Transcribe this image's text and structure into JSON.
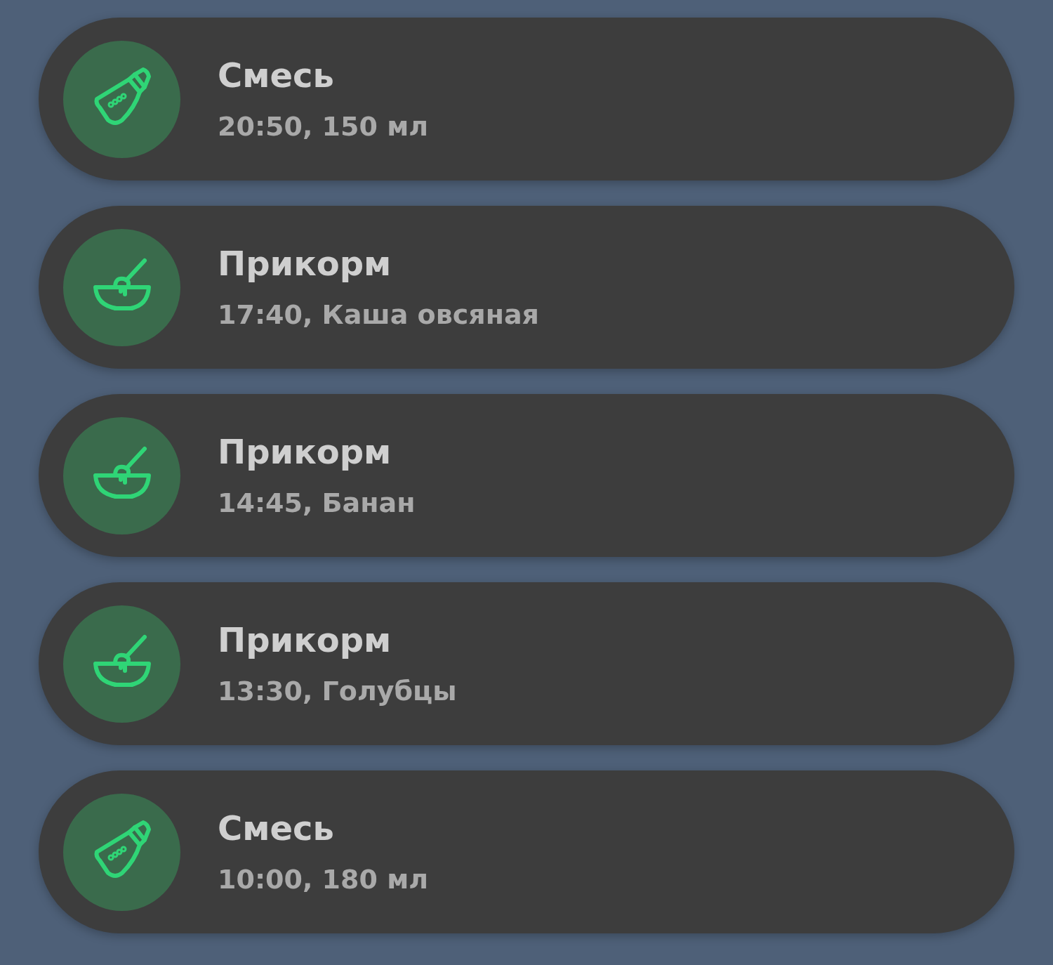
{
  "entries": [
    {
      "kind": "bottle",
      "title": "Смесь",
      "details": "20:50, 150 мл"
    },
    {
      "kind": "bowl",
      "title": "Прикорм",
      "details": "17:40, Каша овсяная"
    },
    {
      "kind": "bowl",
      "title": "Прикорм",
      "details": "14:45, Банан"
    },
    {
      "kind": "bowl",
      "title": "Прикорм",
      "details": "13:30, Голубцы"
    },
    {
      "kind": "bottle",
      "title": "Смесь",
      "details": "10:00, 180 мл"
    }
  ]
}
